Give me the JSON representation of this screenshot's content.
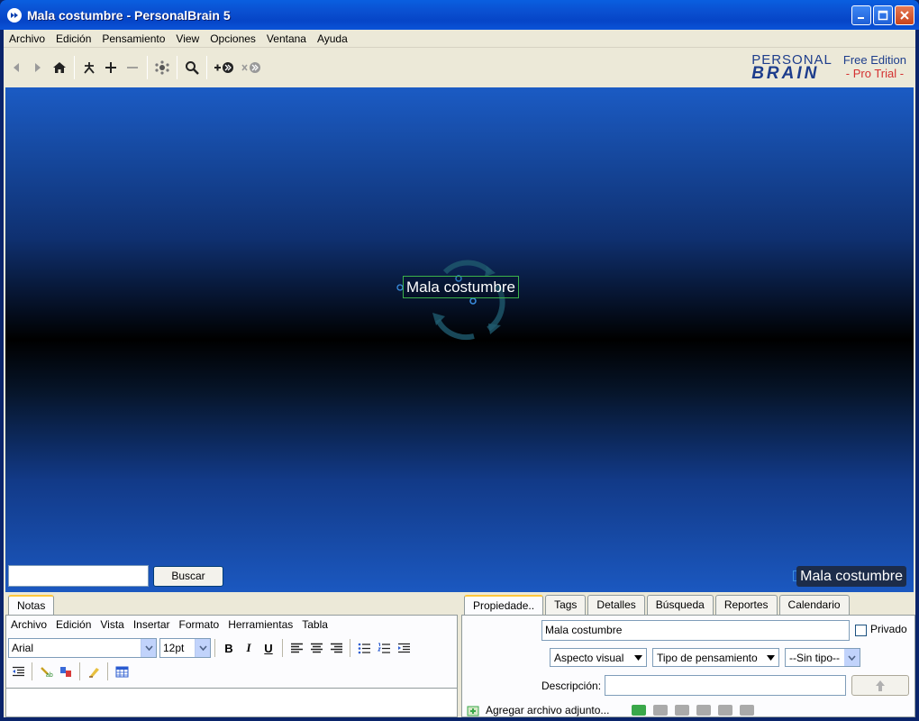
{
  "window": {
    "title": "Mala costumbre - PersonalBrain 5"
  },
  "menubar": {
    "items": [
      "Archivo",
      "Edición",
      "Pensamiento",
      "View",
      "Opciones",
      "Ventana",
      "Ayuda"
    ]
  },
  "toolbar": {
    "brand_line1": "PERSONAL",
    "brand_line2": "BRAIN",
    "edition": "Free Edition",
    "trial": "- Pro Trial -"
  },
  "plex": {
    "central_thought": "Mala costumbre",
    "search_value": "",
    "search_button": "Buscar",
    "active_thought_label": "Mala costumbre"
  },
  "notes": {
    "tab": "Notas",
    "menu": [
      "Archivo",
      "Edición",
      "Vista",
      "Insertar",
      "Formato",
      "Herramientas",
      "Tabla"
    ],
    "font": "Arial",
    "size": "12pt",
    "bold": "B",
    "italic": "I",
    "underline": "U",
    "content": ""
  },
  "properties": {
    "tabs": [
      "Propiedade..",
      "Tags",
      "Detalles",
      "Búsqueda",
      "Reportes",
      "Calendario"
    ],
    "name_value": "Mala costumbre",
    "private_label": "Privado",
    "visual_aspect": "Aspecto visual",
    "thought_type": "Tipo de pensamiento",
    "no_type": "--Sin tipo--",
    "description_label": "Descripción:",
    "description_value": "",
    "attach_label": "Agregar archivo adjunto..."
  },
  "colors": {
    "titlebar": "#0a53d8",
    "plex_top": "#1b5bc4",
    "thought_border": "#3bb24a",
    "trial": "#d43030"
  }
}
